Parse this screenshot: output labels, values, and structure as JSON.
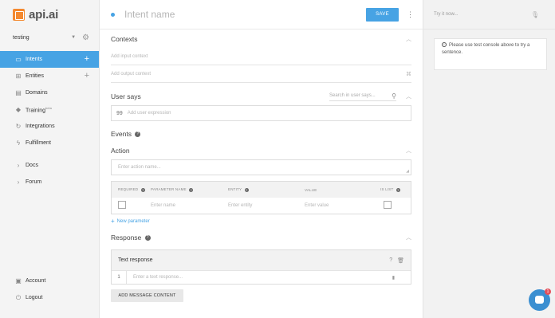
{
  "logo": {
    "text": "api.ai",
    "brand_color": "#f4892f"
  },
  "agent": {
    "name": "testing",
    "caret_icon": "caret-down-icon",
    "settings_icon": "gear-icon"
  },
  "nav": {
    "items": [
      {
        "label": "Intents",
        "icon": "chat-bubble-icon",
        "has_add": true,
        "active": true
      },
      {
        "label": "Entities",
        "icon": "hierarchy-icon",
        "has_add": true
      },
      {
        "label": "Domains",
        "icon": "box-icon"
      },
      {
        "label": "Training",
        "icon": "graduation-cap-icon",
        "badge": "beta"
      },
      {
        "label": "Integrations",
        "icon": "sync-icon"
      },
      {
        "label": "Fulfillment",
        "icon": "lightning-icon"
      },
      {
        "label": "Docs",
        "icon": "chevron-right-icon"
      },
      {
        "label": "Forum",
        "icon": "chevron-right-icon"
      }
    ],
    "bottom": [
      {
        "label": "Account",
        "icon": "account-icon"
      },
      {
        "label": "Logout",
        "icon": "power-icon"
      }
    ]
  },
  "header": {
    "intent_placeholder": "Intent name",
    "save_label": "SAVE"
  },
  "contexts": {
    "title": "Contexts",
    "input_placeholder": "Add input context",
    "output_placeholder": "Add output context"
  },
  "user_says": {
    "title": "User says",
    "search_placeholder": "Search in user says...",
    "expression_placeholder": "Add user expression",
    "quote_glyph": "99"
  },
  "events": {
    "title": "Events"
  },
  "action": {
    "title": "Action",
    "name_placeholder": "Enter action name...",
    "columns": {
      "required": "REQUIRED",
      "parameter_name": "PARAMETER NAME",
      "entity": "ENTITY",
      "value": "VALUE",
      "is_list": "IS LIST"
    },
    "row": {
      "name_placeholder": "Enter name",
      "entity_placeholder": "Enter entity",
      "value_placeholder": "Enter value"
    },
    "new_parameter": "New parameter"
  },
  "response": {
    "title": "Response",
    "card_title": "Text response",
    "row_number": "1",
    "text_placeholder": "Enter a text response...",
    "add_button": "ADD MESSAGE CONTENT"
  },
  "console": {
    "try_placeholder": "Try it now...",
    "info_text": "Please use test console above to try a sentence."
  },
  "chat": {
    "badge": "1"
  },
  "colors": {
    "accent": "#47a3e4",
    "active_nav": "#47a3e4",
    "badge": "#e4505b"
  }
}
